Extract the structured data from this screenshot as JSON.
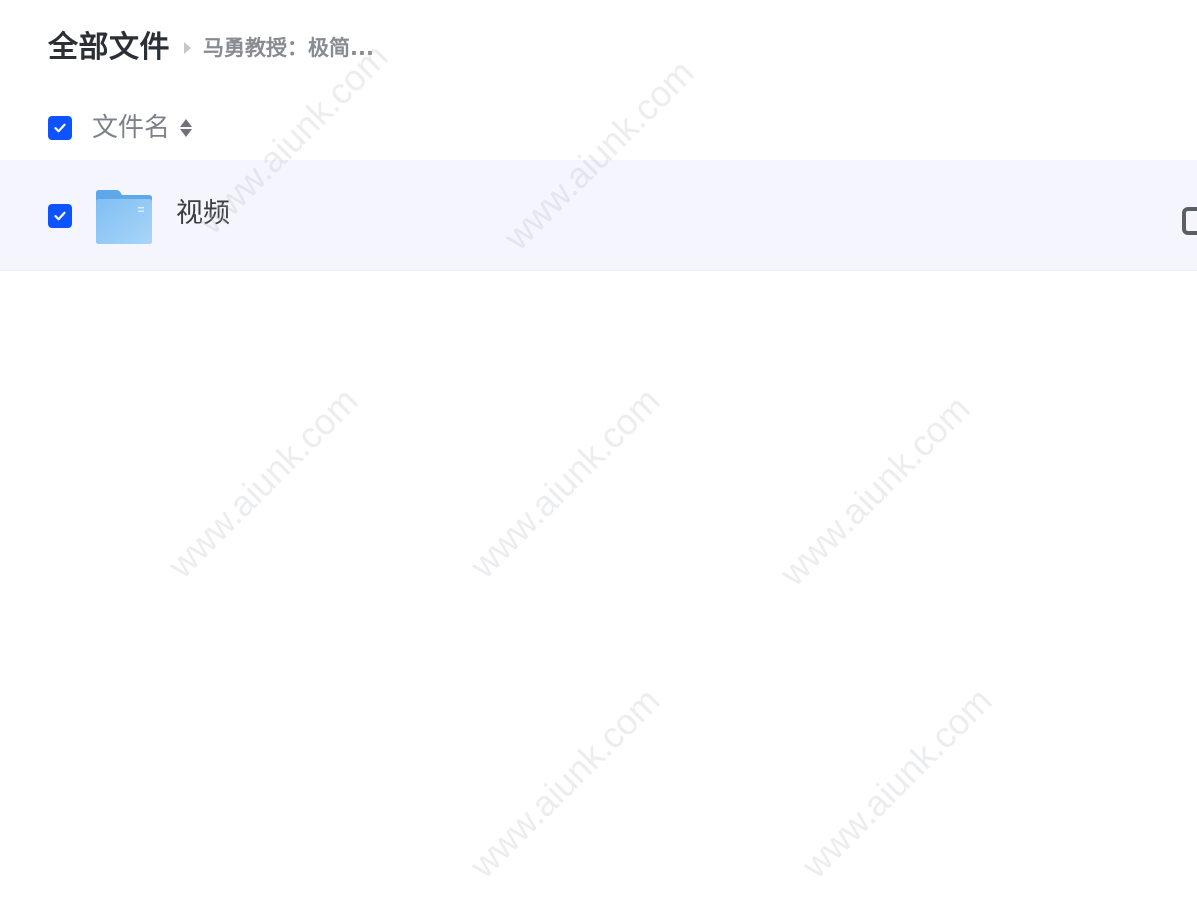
{
  "breadcrumb": {
    "root": "全部文件",
    "current": "马勇教授：极简..."
  },
  "list_header": {
    "name_column": "文件名",
    "select_all_checked": true
  },
  "files": [
    {
      "name": "视频",
      "type": "folder",
      "checked": true
    }
  ],
  "watermark": {
    "text": "www.aiunk.com"
  },
  "colors": {
    "accent": "#0d53ff",
    "row_highlight": "#f5f6fd",
    "folder": "#6fb3ef",
    "title_text": "#2b2f36",
    "muted_text": "#878c93"
  },
  "icons": {
    "breadcrumb_separator": "caret-right-icon",
    "sort": "sort-icon",
    "checkbox": "check-icon",
    "folder": "folder-icon"
  }
}
